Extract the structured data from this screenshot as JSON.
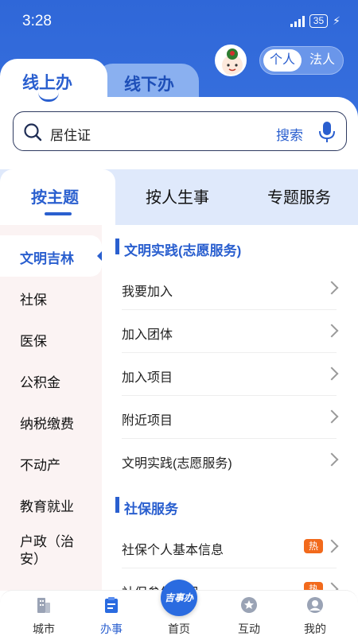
{
  "status_bar": {
    "time": "3:28",
    "battery": "35"
  },
  "header": {
    "toggle": [
      "个人",
      "法人"
    ],
    "tabs": [
      "线上办",
      "线下办"
    ]
  },
  "search": {
    "value": "居住证",
    "button": "搜索"
  },
  "category_tabs": [
    "按主题",
    "按人生事",
    "专题服务"
  ],
  "sidebar": {
    "items": [
      "文明吉林",
      "社保",
      "医保",
      "公积金",
      "纳税缴费",
      "不动产",
      "教育就业",
      "户政（治安）"
    ]
  },
  "sections": [
    {
      "title": "文明实践(志愿服务)",
      "items": [
        "我要加入",
        "加入团体",
        "加入项目",
        "附近项目",
        "文明实践(志愿服务)"
      ]
    },
    {
      "title": "社保服务",
      "items": [
        "社保个人基本信息",
        "社保参保证明"
      ],
      "hot_badge": "热"
    }
  ],
  "bottom_nav": {
    "items": [
      "城市",
      "办事",
      "首页",
      "互动",
      "我的"
    ],
    "center_logo": "吉事办"
  },
  "colors": {
    "primary": "#2a5fcf",
    "hot": "#f26a1c"
  }
}
